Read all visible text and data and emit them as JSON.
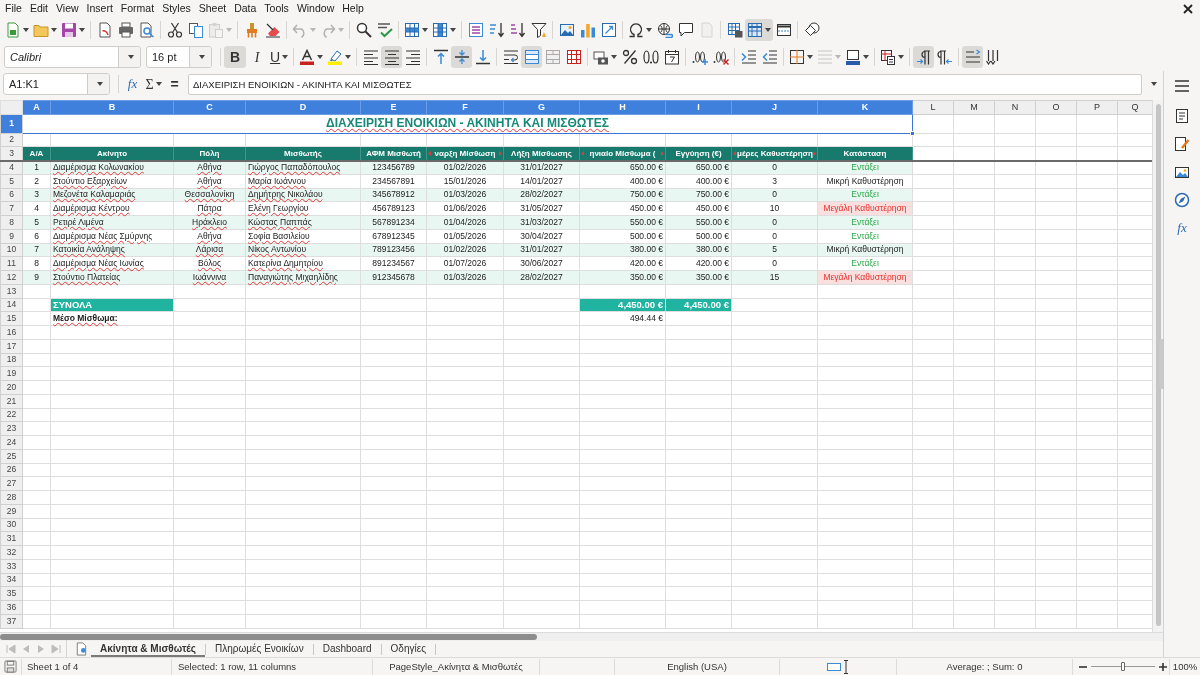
{
  "menu": [
    "File",
    "Edit",
    "View",
    "Insert",
    "Format",
    "Styles",
    "Sheet",
    "Data",
    "Tools",
    "Window",
    "Help"
  ],
  "standard_toolbar": {
    "paste_enabled": false,
    "undo_enabled": false,
    "redo_enabled": false,
    "header_footer_enabled": false,
    "freeze_rows_active": true
  },
  "formatting_toolbar": {
    "font_name": "Calibri",
    "font_size": "16 pt",
    "style_buttons": [
      {
        "label": "B",
        "on": true
      },
      {
        "label": "I",
        "on": false
      },
      {
        "label": "U",
        "on": false
      }
    ],
    "alignment_buttons": [
      {
        "selected": false
      },
      {
        "selected": true
      },
      {
        "selected": false
      }
    ],
    "vertical_alignment_buttons": [
      {
        "selected": false
      },
      {
        "selected": true
      },
      {
        "selected": false
      }
    ],
    "merge_and_center": true,
    "border_style_enabled": false,
    "paragraph_direction_buttons": [
      {
        "selected": true
      },
      {
        "selected": false
      }
    ],
    "text_direction_buttons": [
      {
        "selected": true
      },
      {
        "selected": false
      }
    ]
  },
  "formula_bar": {
    "name_box": "A1:K1",
    "wizard_label": "fx",
    "sum_label": "Σ",
    "equals_label": "=",
    "content": "ΔΙΑΧΕΙΡΙΣΗ ΕΝΟΙΚΙΩΝ - ΑΚΙΝΗΤΑ ΚΑΙ ΜΙΣΘΩΤΕΣ"
  },
  "sidebar": {
    "functions_label": "fx"
  },
  "sheet": {
    "columns": [
      {
        "label": "A",
        "selected": true
      },
      {
        "label": "B",
        "selected": true
      },
      {
        "label": "C",
        "selected": true
      },
      {
        "label": "D",
        "selected": true
      },
      {
        "label": "E",
        "selected": true
      },
      {
        "label": "F",
        "selected": true
      },
      {
        "label": "G",
        "selected": true
      },
      {
        "label": "H",
        "selected": true
      },
      {
        "label": "I",
        "selected": true
      },
      {
        "label": "J",
        "selected": true
      },
      {
        "label": "K",
        "selected": true
      },
      {
        "label": "L",
        "selected": false
      },
      {
        "label": "M",
        "selected": false
      },
      {
        "label": "N",
        "selected": false
      },
      {
        "label": "O",
        "selected": false
      },
      {
        "label": "P",
        "selected": false
      },
      {
        "label": "Q",
        "selected": false
      }
    ],
    "rows": [
      {
        "label": "1",
        "selected": true
      },
      {
        "label": "2",
        "selected": false
      },
      {
        "label": "3",
        "selected": false
      },
      {
        "label": "4",
        "selected": false
      },
      {
        "label": "5",
        "selected": false
      },
      {
        "label": "6",
        "selected": false
      },
      {
        "label": "7",
        "selected": false
      },
      {
        "label": "8",
        "selected": false
      },
      {
        "label": "9",
        "selected": false
      },
      {
        "label": "10",
        "selected": false
      },
      {
        "label": "11",
        "selected": false
      },
      {
        "label": "12",
        "selected": false
      },
      {
        "label": "13",
        "selected": false
      },
      {
        "label": "14",
        "selected": false
      },
      {
        "label": "15",
        "selected": false
      },
      {
        "label": "16",
        "selected": false
      },
      {
        "label": "17",
        "selected": false
      },
      {
        "label": "18",
        "selected": false
      },
      {
        "label": "19",
        "selected": false
      },
      {
        "label": "20",
        "selected": false
      },
      {
        "label": "21",
        "selected": false
      },
      {
        "label": "22",
        "selected": false
      },
      {
        "label": "23",
        "selected": false
      },
      {
        "label": "24",
        "selected": false
      },
      {
        "label": "25",
        "selected": false
      },
      {
        "label": "26",
        "selected": false
      },
      {
        "label": "27",
        "selected": false
      },
      {
        "label": "28",
        "selected": false
      },
      {
        "label": "29",
        "selected": false
      },
      {
        "label": "30",
        "selected": false
      },
      {
        "label": "31",
        "selected": false
      },
      {
        "label": "32",
        "selected": false
      },
      {
        "label": "33",
        "selected": false
      },
      {
        "label": "34",
        "selected": false
      },
      {
        "label": "35",
        "selected": false
      },
      {
        "label": "36",
        "selected": false
      },
      {
        "label": "37",
        "selected": false
      }
    ],
    "autospell": true,
    "title": "ΔΙΑΧΕΙΡΙΣΗ ΕΝΟΙΚΙΩΝ - ΑΚΙΝΗΤΑ ΚΑΙ ΜΙΣΘΩΤΕΣ",
    "title_selected": true,
    "table_header": [
      {
        "text": "Α/Α",
        "overflow": false
      },
      {
        "text": "Ακίνητο",
        "overflow": false
      },
      {
        "text": "Πόλη",
        "overflow": false
      },
      {
        "text": "Μισθωτής",
        "overflow": false
      },
      {
        "text": "ΑΦΜ Μισθωτή",
        "overflow": false
      },
      {
        "text": "ναρξη Μίσθωση",
        "overflow": true
      },
      {
        "text": "Λήξη Μίσθωσης",
        "overflow": false
      },
      {
        "text": "ηνιαίο Μίσθωμα (",
        "overflow": true
      },
      {
        "text": "Εγγύηση (€)",
        "overflow": false
      },
      {
        "text": "μέρες Καθυστέρηση",
        "overflow": true
      },
      {
        "text": "Κατάσταση",
        "overflow": false
      }
    ],
    "records": [
      {
        "no": "1",
        "property": "Διαμέρισμα Κολωνακίου",
        "city": "Αθήνα",
        "tenant": "Γιώργος Παπαδόπουλος",
        "tax_id": "123456789",
        "start": "01/02/2026",
        "end": "31/01/2027",
        "rent": "650.00 €",
        "deposit": "650.00 €",
        "days_late": "0",
        "status": {
          "text": "Εντάξει",
          "kind": "ok"
        }
      },
      {
        "no": "2",
        "property": "Στούντιο Εξαρχείων",
        "city": "Αθήνα",
        "tenant": "Μαρία Ιωάννου",
        "tax_id": "234567891",
        "start": "15/01/2026",
        "end": "14/01/2027",
        "rent": "400.00 €",
        "deposit": "400.00 €",
        "days_late": "3",
        "status": {
          "text": "Μικρή Καθυστέρηση",
          "kind": "minor"
        }
      },
      {
        "no": "3",
        "property": "Μεζονέτα Καλαμαριάς",
        "city": "Θεσσαλονίκη",
        "tenant": "Δημήτρης Νικολάου",
        "tax_id": "345678912",
        "start": "01/03/2026",
        "end": "28/02/2027",
        "rent": "750.00 €",
        "deposit": "750.00 €",
        "days_late": "0",
        "status": {
          "text": "Εντάξει",
          "kind": "ok"
        }
      },
      {
        "no": "4",
        "property": "Διαμέρισμα Κέντρου",
        "city": "Πάτρα",
        "tenant": "Ελένη Γεωργίου",
        "tax_id": "456789123",
        "start": "01/06/2026",
        "end": "31/05/2027",
        "rent": "450.00 €",
        "deposit": "450.00 €",
        "days_late": "10",
        "status": {
          "text": "Μεγάλη Καθυστέρηση",
          "kind": "major"
        }
      },
      {
        "no": "5",
        "property": "Ρετιρέ Λιμένα",
        "city": "Ηράκλειο",
        "tenant": "Κώστας Παππάς",
        "tax_id": "567891234",
        "start": "01/04/2026",
        "end": "31/03/2027",
        "rent": "550.00 €",
        "deposit": "550.00 €",
        "days_late": "0",
        "status": {
          "text": "Εντάξει",
          "kind": "ok"
        }
      },
      {
        "no": "6",
        "property": "Διαμέρισμα Νέας Σμύρνης",
        "city": "Αθήνα",
        "tenant": "Σοφία Βασιλείου",
        "tax_id": "678912345",
        "start": "01/05/2026",
        "end": "30/04/2027",
        "rent": "500.00 €",
        "deposit": "500.00 €",
        "days_late": "0",
        "status": {
          "text": "Εντάξει",
          "kind": "ok"
        }
      },
      {
        "no": "7",
        "property": "Κατοικία Ανάληψης",
        "city": "Λάρισα",
        "tenant": "Νίκος Αντωνίου",
        "tax_id": "789123456",
        "start": "01/02/2026",
        "end": "31/01/2027",
        "rent": "380.00 €",
        "deposit": "380.00 €",
        "days_late": "5",
        "status": {
          "text": "Μικρή Καθυστέρηση",
          "kind": "minor"
        }
      },
      {
        "no": "8",
        "property": "Διαμέρισμα Νέας Ιωνίας",
        "city": "Βόλος",
        "tenant": "Κατερίνα Δημητρίου",
        "tax_id": "891234567",
        "start": "01/07/2026",
        "end": "30/06/2027",
        "rent": "420.00 €",
        "deposit": "420.00 €",
        "days_late": "0",
        "status": {
          "text": "Εντάξει",
          "kind": "ok"
        }
      },
      {
        "no": "9",
        "property": "Στούντιο Πλατείας",
        "city": "Ιωάννινα",
        "tenant": "Παναγιώτης Μιχαηλίδης",
        "tax_id": "912345678",
        "start": "01/03/2026",
        "end": "28/02/2027",
        "rent": "350.00 €",
        "deposit": "350.00 €",
        "days_late": "15",
        "status": {
          "text": "Μεγάλη Καθυστέρηση",
          "kind": "major"
        }
      }
    ],
    "totals": {
      "label": "ΣΥΝΟΛΑ",
      "rent": "4,450.00 €",
      "deposit": "4,450.00 €"
    },
    "average": {
      "label": "Μέσο Μίσθωμα:",
      "rent": "494.44 €"
    }
  },
  "sheet_tab_bar": {
    "navigation_enabled": false,
    "tabs": [
      {
        "label": "Ακίνητα & Μισθωτές",
        "selected": true
      },
      {
        "label": "Πληρωμές Ενοικίων",
        "selected": false
      },
      {
        "label": "Dashboard",
        "selected": false
      },
      {
        "label": "Οδηγίες",
        "selected": false
      }
    ]
  },
  "status_bar": {
    "sheet_position": "Sheet 1 of 4",
    "selection": "Selected: 1 row, 11 columns",
    "page_style": "PageStyle_Ακίνητα & Μισθωτές",
    "language": "English (USA)",
    "summary": "Average: ; Sum: 0",
    "zoom": {
      "level": 0.5,
      "label": "100%"
    }
  }
}
